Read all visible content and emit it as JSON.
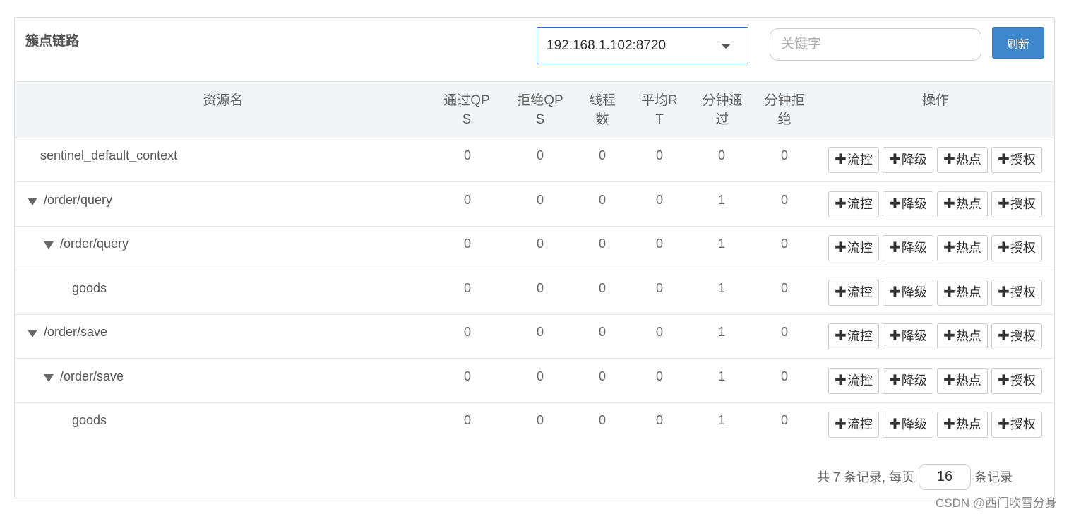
{
  "panel": {
    "title": "簇点链路",
    "machine_select": {
      "value": "192.168.1.102:8720"
    },
    "search": {
      "placeholder": "关键字",
      "value": ""
    },
    "refresh_label": "刷新"
  },
  "table": {
    "headers": {
      "resource": "资源名",
      "pass_qps": [
        "通过QP",
        "S"
      ],
      "block_qps": [
        "拒绝QP",
        "S"
      ],
      "threads": [
        "线程",
        "数"
      ],
      "avg_rt": [
        "平均R",
        "T"
      ],
      "pass_min": [
        "分钟通",
        "过"
      ],
      "block_min": [
        "分钟拒",
        "绝"
      ],
      "ops": "操作"
    },
    "op_labels": {
      "plus": "✚",
      "flow": "流控",
      "degrade": "降级",
      "hot": "热点",
      "auth": "授权"
    },
    "rows": [
      {
        "name": "sentinel_default_context",
        "level": 0,
        "expandable": false,
        "pass_qps": "0",
        "block_qps": "0",
        "threads": "0",
        "avg_rt": "0",
        "pass_min": "0",
        "block_min": "0"
      },
      {
        "name": "/order/query",
        "level": 0,
        "expandable": true,
        "pass_qps": "0",
        "block_qps": "0",
        "threads": "0",
        "avg_rt": "0",
        "pass_min": "1",
        "block_min": "0"
      },
      {
        "name": "/order/query",
        "level": 1,
        "expandable": true,
        "pass_qps": "0",
        "block_qps": "0",
        "threads": "0",
        "avg_rt": "0",
        "pass_min": "1",
        "block_min": "0"
      },
      {
        "name": "goods",
        "level": 2,
        "expandable": false,
        "pass_qps": "0",
        "block_qps": "0",
        "threads": "0",
        "avg_rt": "0",
        "pass_min": "1",
        "block_min": "0"
      },
      {
        "name": "/order/save",
        "level": 0,
        "expandable": true,
        "pass_qps": "0",
        "block_qps": "0",
        "threads": "0",
        "avg_rt": "0",
        "pass_min": "1",
        "block_min": "0"
      },
      {
        "name": "/order/save",
        "level": 1,
        "expandable": true,
        "pass_qps": "0",
        "block_qps": "0",
        "threads": "0",
        "avg_rt": "0",
        "pass_min": "1",
        "block_min": "0"
      },
      {
        "name": "goods",
        "level": 2,
        "expandable": false,
        "pass_qps": "0",
        "block_qps": "0",
        "threads": "0",
        "avg_rt": "0",
        "pass_min": "1",
        "block_min": "0"
      }
    ]
  },
  "pager": {
    "prefix": "共 7 条记录, 每页",
    "page_size": "16",
    "suffix": "条记录"
  },
  "watermark": "CSDN @西门吹雪分身"
}
